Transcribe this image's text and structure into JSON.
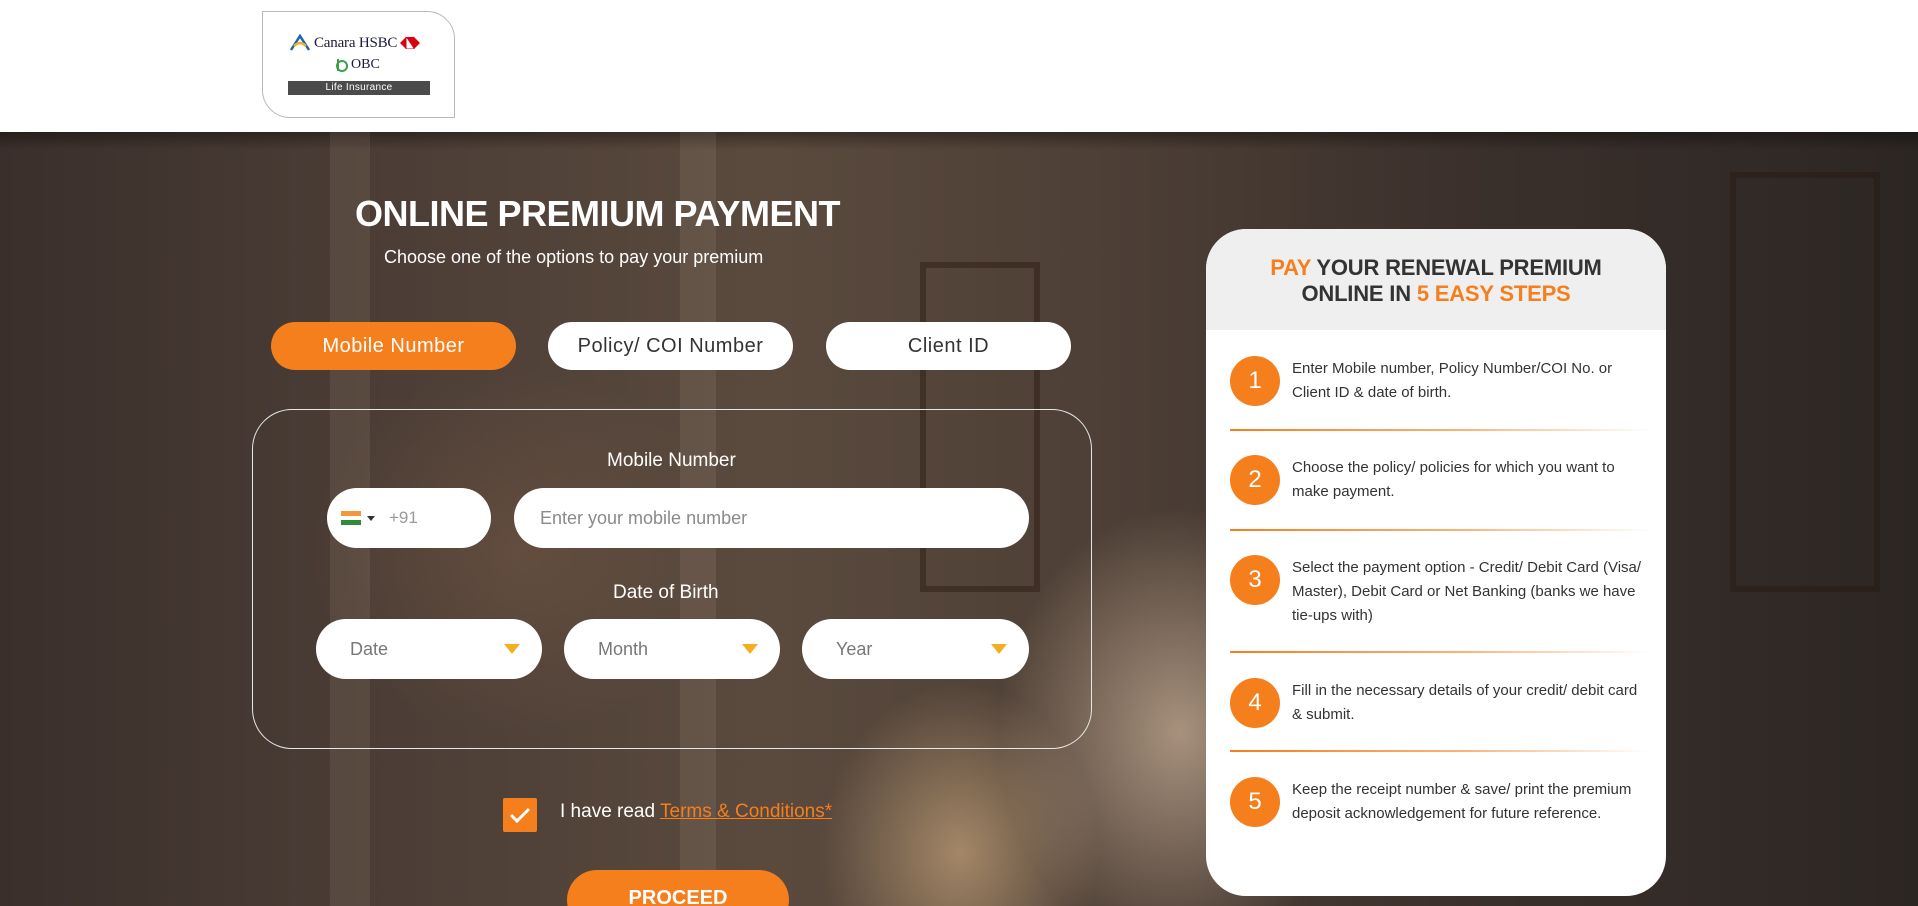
{
  "header": {
    "logo": {
      "brand": "Canara HSBC",
      "partner": "OBC",
      "tagline": "Life Insurance"
    }
  },
  "main": {
    "title": "ONLINE PREMIUM PAYMENT",
    "subtitle": "Choose one of the options to pay your premium",
    "tabs": [
      {
        "label": "Mobile Number",
        "active": true
      },
      {
        "label": "Policy/ COI Number",
        "active": false
      },
      {
        "label": "Client ID",
        "active": false
      }
    ],
    "form": {
      "mobile_label": "Mobile Number",
      "country_code": "+91",
      "mobile_placeholder": "Enter your mobile number",
      "dob_label": "Date of Birth",
      "date_placeholder": "Date",
      "month_placeholder": "Month",
      "year_placeholder": "Year"
    },
    "terms": {
      "prefix": "I have read ",
      "link": "Terms & Conditions*",
      "checked": true
    },
    "proceed_label": "PROCEED"
  },
  "steps_card": {
    "heading_pay": "PAY",
    "heading_rest1": " YOUR RENEWAL PREMIUM",
    "heading_rest2": "ONLINE IN ",
    "heading_highlight2": "5 EASY STEPS",
    "steps": [
      {
        "num": "1",
        "text": "Enter Mobile number, Policy Number/COI No. or Client ID & date of birth."
      },
      {
        "num": "2",
        "text": "Choose the policy/ policies for which you want to make payment."
      },
      {
        "num": "3",
        "text": "Select the payment option - Credit/ Debit Card (Visa/ Master), Debit Card or Net Banking (banks we have tie-ups with)"
      },
      {
        "num": "4",
        "text": "Fill in the necessary details of your credit/ debit card & submit."
      },
      {
        "num": "5",
        "text": "Keep the receipt number & save/ print the premium deposit acknowledgement for future reference."
      }
    ]
  },
  "colors": {
    "accent": "#f57e1d",
    "arrow": "#f2b01e",
    "text_dark": "#333333"
  }
}
